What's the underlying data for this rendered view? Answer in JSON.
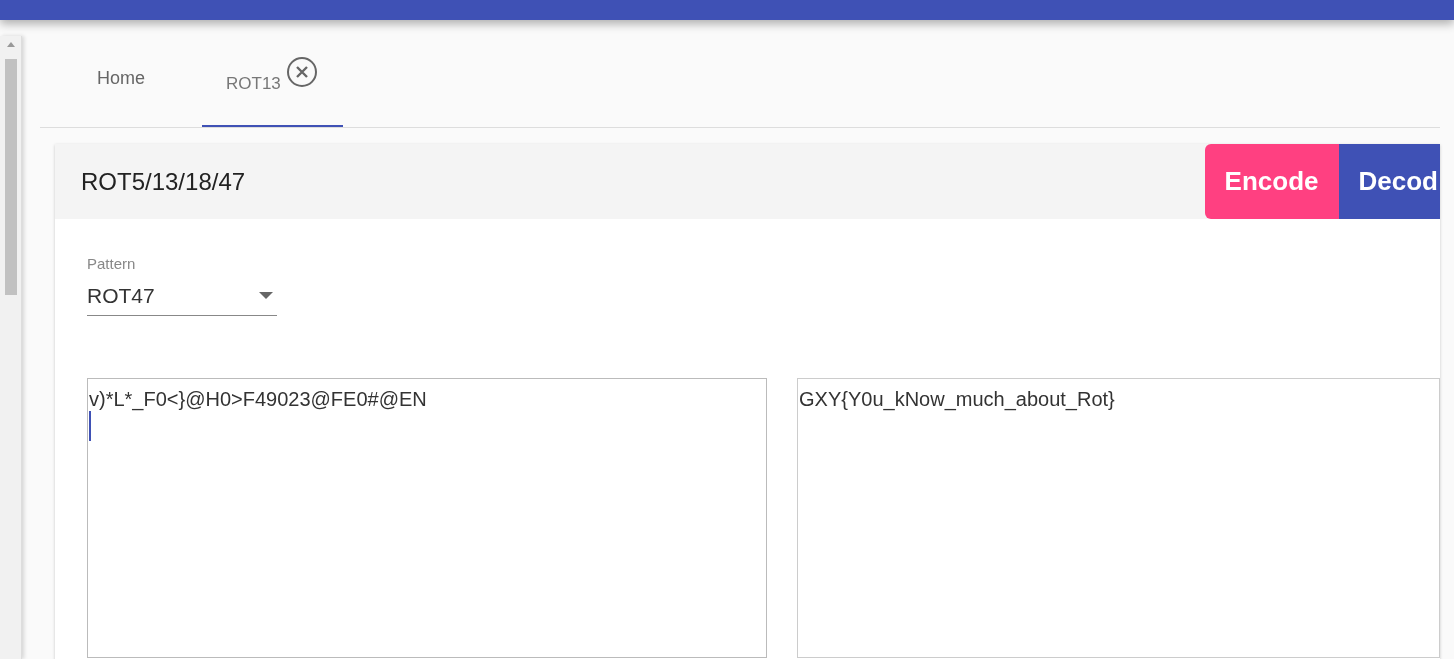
{
  "tabs": [
    {
      "label": "Home",
      "selected": false,
      "closable": false
    },
    {
      "label": "ROT13",
      "selected": true,
      "closable": true
    }
  ],
  "card": {
    "title": "ROT5/13/18/47",
    "buttons": [
      {
        "label": "Encode",
        "kind": "accent"
      },
      {
        "label": "Decod",
        "kind": "primary"
      }
    ],
    "pattern": {
      "label": "Pattern",
      "value": "ROT47"
    },
    "inputs": [
      {
        "value": "v)*L*_F0<}@H0>F49023@FE0#@EN",
        "focused": true
      },
      {
        "value": "GXY{Y0u_kNow_much_about_Rot}",
        "focused": false
      }
    ]
  }
}
